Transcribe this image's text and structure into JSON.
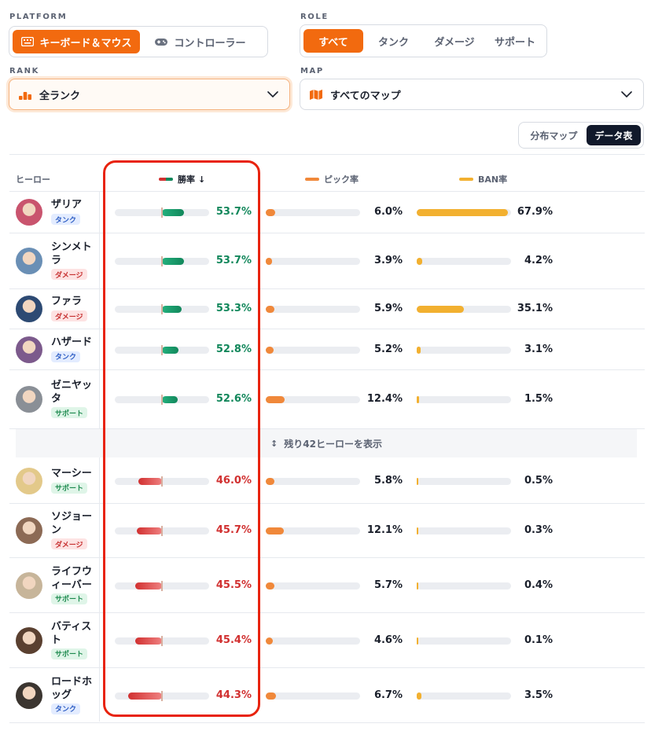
{
  "filters": {
    "platform": {
      "label": "PLATFORM",
      "options": [
        {
          "label": "キーボード＆マウス",
          "icon": "keyboard-icon",
          "active": true
        },
        {
          "label": "コントローラー",
          "icon": "gamepad-icon",
          "active": false
        }
      ]
    },
    "role": {
      "label": "ROLE",
      "options": [
        {
          "label": "すべて",
          "active": true
        },
        {
          "label": "タンク",
          "active": false
        },
        {
          "label": "ダメージ",
          "active": false
        },
        {
          "label": "サポート",
          "active": false
        }
      ]
    },
    "rank": {
      "label": "RANK",
      "value": "全ランク",
      "icon": "rank-bars-icon"
    },
    "map": {
      "label": "MAP",
      "value": "すべてのマップ",
      "icon": "map-icon"
    }
  },
  "view_toggle": {
    "options": [
      {
        "label": "分布マップ",
        "active": false
      },
      {
        "label": "データ表",
        "active": true
      }
    ]
  },
  "table": {
    "headers": {
      "hero": "ヒーロー",
      "winrate": "勝率",
      "sort_arrow": "↓",
      "pickrate": "ピック率",
      "banrate": "BAN率"
    },
    "winrate_baseline": 50,
    "top_rows": [
      {
        "name": "ザリア",
        "role": "タンク",
        "role_key": "tank",
        "winrate": 53.7,
        "winrate_label": "53.7%",
        "pickrate": 6.0,
        "pickrate_label": "6.0%",
        "banrate": 67.9,
        "banrate_label": "67.9%",
        "avatar_color": "#c9546e"
      },
      {
        "name": "シンメトラ",
        "role": "ダメージ",
        "role_key": "dmg",
        "winrate": 53.7,
        "winrate_label": "53.7%",
        "pickrate": 3.9,
        "pickrate_label": "3.9%",
        "banrate": 4.2,
        "banrate_label": "4.2%",
        "avatar_color": "#6a8fb5"
      },
      {
        "name": "ファラ",
        "role": "ダメージ",
        "role_key": "dmg",
        "winrate": 53.3,
        "winrate_label": "53.3%",
        "pickrate": 5.9,
        "pickrate_label": "5.9%",
        "banrate": 35.1,
        "banrate_label": "35.1%",
        "avatar_color": "#2d4a73"
      },
      {
        "name": "ハザード",
        "role": "タンク",
        "role_key": "tank",
        "winrate": 52.8,
        "winrate_label": "52.8%",
        "pickrate": 5.2,
        "pickrate_label": "5.2%",
        "banrate": 3.1,
        "banrate_label": "3.1%",
        "avatar_color": "#7c5a8c"
      },
      {
        "name": "ゼニヤッタ",
        "role": "サポート",
        "role_key": "sup",
        "winrate": 52.6,
        "winrate_label": "52.6%",
        "pickrate": 12.4,
        "pickrate_label": "12.4%",
        "banrate": 1.5,
        "banrate_label": "1.5%",
        "avatar_color": "#8a8f96"
      }
    ],
    "show_more": {
      "label": "残り42ヒーローを表示",
      "icon": "expand-vertical-icon"
    },
    "bottom_rows": [
      {
        "name": "マーシー",
        "role": "サポート",
        "role_key": "sup",
        "winrate": 46.0,
        "winrate_label": "46.0%",
        "pickrate": 5.8,
        "pickrate_label": "5.8%",
        "banrate": 0.5,
        "banrate_label": "0.5%",
        "avatar_color": "#e3c98a"
      },
      {
        "name": "ソジョーン",
        "role": "ダメージ",
        "role_key": "dmg",
        "winrate": 45.7,
        "winrate_label": "45.7%",
        "pickrate": 12.1,
        "pickrate_label": "12.1%",
        "banrate": 0.3,
        "banrate_label": "0.3%",
        "avatar_color": "#8c6a55"
      },
      {
        "name": "ライフウィーバー",
        "role": "サポート",
        "role_key": "sup",
        "winrate": 45.5,
        "winrate_label": "45.5%",
        "pickrate": 5.7,
        "pickrate_label": "5.7%",
        "banrate": 0.4,
        "banrate_label": "0.4%",
        "avatar_color": "#c7b59a"
      },
      {
        "name": "バティスト",
        "role": "サポート",
        "role_key": "sup",
        "winrate": 45.4,
        "winrate_label": "45.4%",
        "pickrate": 4.6,
        "pickrate_label": "4.6%",
        "banrate": 0.1,
        "banrate_label": "0.1%",
        "avatar_color": "#5a4030"
      },
      {
        "name": "ロードホッグ",
        "role": "タンク",
        "role_key": "tank",
        "winrate": 44.3,
        "winrate_label": "44.3%",
        "pickrate": 6.7,
        "pickrate_label": "6.7%",
        "banrate": 3.5,
        "banrate_label": "3.5%",
        "avatar_color": "#3b3530"
      }
    ]
  },
  "colors": {
    "accent": "#f26a0f",
    "winrate_positive": "#12875b",
    "winrate_negative": "#d13030",
    "pickrate_bar": "#f0883a",
    "banrate_bar": "#f2b030",
    "highlight": "#e8230e"
  }
}
